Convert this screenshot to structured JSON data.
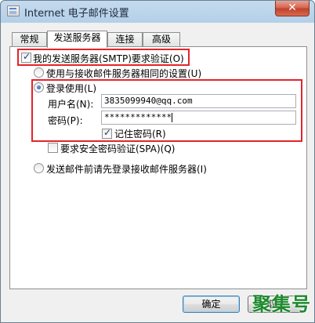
{
  "window": {
    "title": "Internet 电子邮件设置",
    "close_glyph": "✕"
  },
  "tabs": [
    {
      "label": "常规"
    },
    {
      "label": "发送服务器"
    },
    {
      "label": "连接"
    },
    {
      "label": "高级"
    }
  ],
  "outgoing": {
    "requires_auth_label": "我的发送服务器(SMTP)要求验证(O)",
    "requires_auth_checked": true,
    "use_same_settings_label": "使用与接收邮件服务器相同的设置(U)",
    "use_same_settings_selected": false,
    "log_on_using_label": "登录使用(L)",
    "log_on_using_selected": true,
    "username_label": "用户名(N):",
    "username_value": "3835099940@qq.com",
    "password_label": "密码(P):",
    "password_value": "*************",
    "remember_password_label": "记住密码(R)",
    "remember_password_checked": true,
    "spa_label": "要求安全密码验证(SPA)(Q)",
    "spa_checked": false,
    "logon_before_send_label": "发送邮件前请先登录接收邮件服务器(I)",
    "logon_before_send_selected": false
  },
  "footer": {
    "ok_label": "确定",
    "cancel_label": "取消"
  },
  "watermark": {
    "text": "聚集号"
  },
  "colors": {
    "highlight_box": "#e3242b",
    "watermark": "#1f8a2e"
  }
}
